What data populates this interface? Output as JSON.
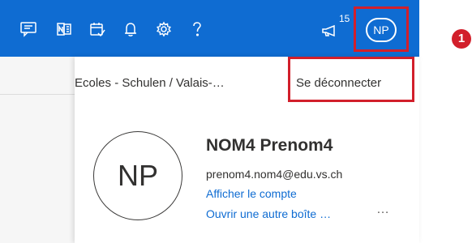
{
  "topbar": {
    "icons": [
      "feedback-icon",
      "onenote-icon",
      "calendar-check-icon",
      "bell-icon",
      "gear-icon",
      "help-icon",
      "megaphone-icon"
    ],
    "notification_count": "15",
    "avatar_initials": "NP",
    "color": "#0f6cd2"
  },
  "annotation": {
    "step": "1",
    "color": "#d21f2b"
  },
  "account_panel": {
    "organization": "Ecoles - Schulen / Valais-…",
    "sign_out_label": "Se déconnecter",
    "avatar_initials": "NP",
    "user_name": "NOM4 Prenom4",
    "user_email": "prenom4.nom4@edu.vs.ch",
    "view_account_link": "Afficher le compte",
    "open_other_mailbox_link": "Ouvrir une autre boîte …",
    "more_options": "…"
  }
}
